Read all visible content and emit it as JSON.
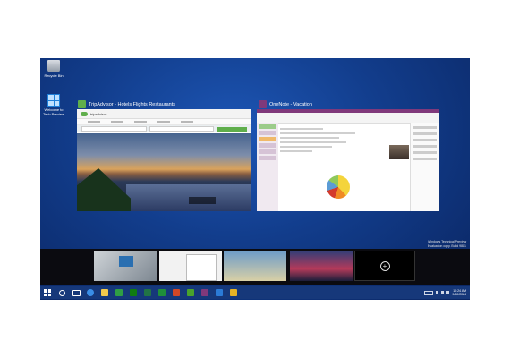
{
  "desktop": {
    "icons": [
      {
        "label": "Recycle Bin"
      },
      {
        "label": "Welcome to Tech Preview"
      }
    ]
  },
  "windows": [
    {
      "title": "TripAdvisor - Hotels Flights Restaurants",
      "badge_color": "#5fae4b",
      "site_name": "tripadvisor"
    },
    {
      "title": "OneNote - Vacation",
      "badge_color": "#80397b"
    }
  ],
  "task_view": {
    "new_desktop_symbol": "+"
  },
  "watermark": {
    "line1": "Windows Technical Preview",
    "line2": "Evaluation copy. Build 9841"
  },
  "taskbar": {
    "apps": [
      {
        "icon": "start-icon",
        "color": "#ffffff"
      },
      {
        "icon": "search-icon",
        "color": "#ffffff"
      },
      {
        "icon": "task-view-icon",
        "color": "#ffffff"
      },
      {
        "icon": "internet-explorer-icon",
        "color": "#3a8ee6"
      },
      {
        "icon": "file-explorer-icon",
        "color": "#f2c94c"
      },
      {
        "icon": "store-icon",
        "color": "#2f9e44"
      },
      {
        "icon": "xbox-icon",
        "color": "#107c10"
      },
      {
        "icon": "excel-icon",
        "color": "#217346"
      },
      {
        "icon": "sheets-icon",
        "color": "#1f8f3a"
      },
      {
        "icon": "powerpoint-icon",
        "color": "#d24726"
      },
      {
        "icon": "games-icon",
        "color": "#4aa32c"
      },
      {
        "icon": "onenote-icon",
        "color": "#80397b"
      },
      {
        "icon": "photos-icon",
        "color": "#2b7bd6"
      },
      {
        "icon": "maps-icon",
        "color": "#e6b325"
      }
    ],
    "clock_time": "10:24 AM",
    "clock_date": "9/30/2014"
  }
}
